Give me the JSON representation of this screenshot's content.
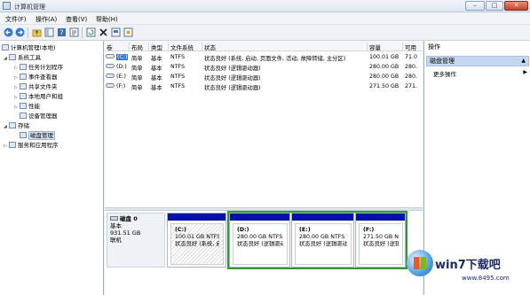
{
  "window": {
    "title": "计算机管理",
    "minimize": "–",
    "maximize": "□",
    "close": "✕"
  },
  "menubar": {
    "items": [
      "文件(F)",
      "操作(A)",
      "查看(V)",
      "帮助(H)"
    ]
  },
  "toolbar": {
    "icons": [
      "back-arrow-icon",
      "forward-arrow-icon",
      "up-folder-icon",
      "show-tree-icon",
      "help-icon",
      "properties-icon",
      "refresh-icon",
      "delete-icon",
      "connect-icon",
      "settings-icon"
    ]
  },
  "tree": {
    "root": "计算机管理(本地)",
    "system_tools": "系统工具",
    "task_scheduler": "任务计划程序",
    "event_viewer": "事件查看器",
    "shared_folders": "共享文件夹",
    "local_users": "本地用户和组",
    "performance": "性能",
    "device_manager": "设备管理器",
    "storage": "存储",
    "disk_management": "磁盘管理",
    "services_apps": "服务和应用程序"
  },
  "volumes": {
    "headers": [
      "卷",
      "布局",
      "类型",
      "文件系统",
      "状态",
      "容量",
      "可用"
    ],
    "rows": [
      {
        "vol": "(C:)",
        "layout": "简单",
        "type": "基本",
        "fs": "NTFS",
        "status": "状态良好 (系统, 启动, 页面文件, 活动, 故障转储, 主分区)",
        "capacity": "100.01 GB",
        "free": "71.0"
      },
      {
        "vol": "(D:)",
        "layout": "简单",
        "type": "基本",
        "fs": "NTFS",
        "status": "状态良好 (逻辑驱动器)",
        "capacity": "280.00 GB",
        "free": "280."
      },
      {
        "vol": "(E:)",
        "layout": "简单",
        "type": "基本",
        "fs": "NTFS",
        "status": "状态良好 (逻辑驱动器)",
        "capacity": "280.00 GB",
        "free": "280."
      },
      {
        "vol": "(F:)",
        "layout": "简单",
        "type": "基本",
        "fs": "NTFS",
        "status": "状态良好 (逻辑驱动器)",
        "capacity": "271.50 GB",
        "free": "271."
      }
    ]
  },
  "disk": {
    "name": "磁盘 0",
    "type": "基本",
    "size": "931.51 GB",
    "status": "联机",
    "partitions": [
      {
        "name": "(C:)",
        "size": "100.01 GB NTFS",
        "status": "状态良好 (系统, 启"
      },
      {
        "name": "(D:)",
        "size": "280.00 GB NTFS",
        "status": "状态良好 (逻辑驱动"
      },
      {
        "name": "(E:)",
        "size": "280.00 GB NTFS",
        "status": "状态良好 (逻辑驱动"
      },
      {
        "name": "(F:)",
        "size": "271.50 GB NTFS",
        "status": "状态良好 (逻辑驱动"
      }
    ]
  },
  "actions": {
    "header": "操作",
    "section": "磁盘管理",
    "more": "更多操作"
  },
  "watermark": {
    "brand": "win7下载吧",
    "url": "www.8495.com"
  }
}
